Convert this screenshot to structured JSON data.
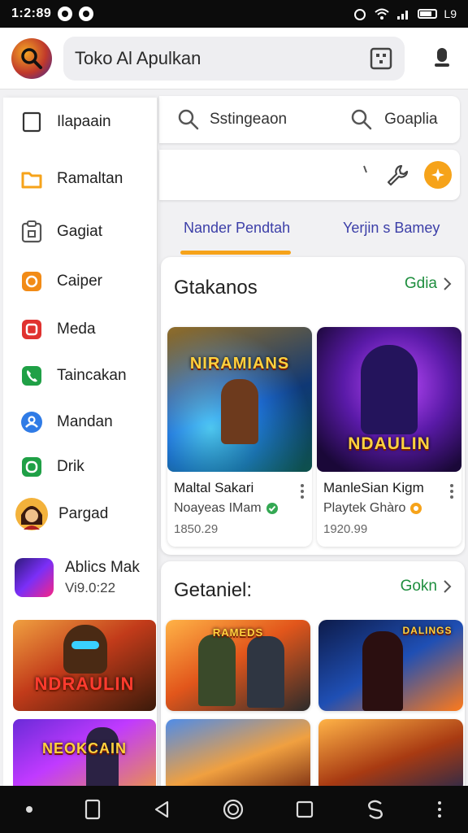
{
  "status_bar": {
    "time": "1:2:89",
    "battery_label": "L9"
  },
  "search": {
    "text": "Toko Al Apulkan"
  },
  "drawer": {
    "items": [
      {
        "label": "Ilapaain",
        "icon": "square-outline-icon"
      },
      {
        "label": "Ramaltan",
        "icon": "folder-icon"
      },
      {
        "label": "Gagiat",
        "icon": "clipboard-icon"
      },
      {
        "label": "Caiper",
        "icon": "orange-square-icon"
      },
      {
        "label": "Meda",
        "icon": "media-icon"
      },
      {
        "label": "Taincakan",
        "icon": "phone-icon"
      },
      {
        "label": "Mandan",
        "icon": "person-icon"
      },
      {
        "label": "Drik",
        "icon": "drik-icon"
      },
      {
        "label": "Pargad",
        "icon": "avatar-icon"
      }
    ],
    "app": {
      "name": "Ablics Mak",
      "price": "Vi9.0:22"
    },
    "art_labels": [
      "NDRAULIN",
      "NEOKCAIN"
    ]
  },
  "quick_search": [
    {
      "label": "Sstingeaon",
      "icon": "search-icon"
    },
    {
      "label": "Goaplia",
      "icon": "search-icon"
    }
  ],
  "tabs": [
    {
      "label": "Nander Pendtah",
      "active": true
    },
    {
      "label": "Yerjin s Bamey",
      "active": false
    }
  ],
  "sections": [
    {
      "title": "Gtakanos",
      "link": "Gdia",
      "cards": [
        {
          "title": "Maltal Sakari",
          "subtitle": "Noayeas IMam",
          "badge_color": "#34a853",
          "price": "1850.29",
          "art_label": "NIRAMIANS"
        },
        {
          "title": "ManleSian Kigm",
          "subtitle": "Playtek Ghàro",
          "badge_color": "#f6a31a",
          "price": "1920.99",
          "art_label": "NDAULIN"
        }
      ]
    },
    {
      "title": "Getaniel:",
      "link": "Gokn",
      "cards": [
        {
          "art_label": "RAMEDS"
        },
        {
          "art_label": "DALINGS"
        }
      ]
    }
  ],
  "colors": {
    "accent": "#f6a31a",
    "link": "#1e8e3e",
    "tab": "#3c3fa8",
    "nav": "#0c0c0c"
  }
}
